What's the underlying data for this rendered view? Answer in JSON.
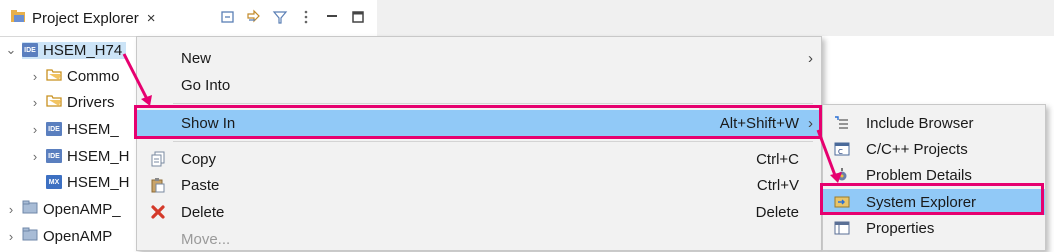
{
  "explorer": {
    "tab_title": "Project Explorer",
    "close_glyph": "×",
    "toolbar_icons": [
      "collapse-all-icon",
      "link-with-editor-icon",
      "filter-icon",
      "view-menu-icon",
      "minimize-icon",
      "maximize-icon"
    ],
    "tree": [
      {
        "label": "HSEM_H74",
        "icon": "ide-project-icon",
        "badge": "IDE",
        "expanded": true,
        "selected": true
      },
      {
        "label": "Commo",
        "icon": "folder-icon",
        "expanded": false
      },
      {
        "label": "Drivers",
        "icon": "folder-icon",
        "expanded": false
      },
      {
        "label": "HSEM_",
        "icon": "ide-project-icon",
        "badge": "IDE",
        "expanded": false
      },
      {
        "label": "HSEM_H",
        "icon": "ide-project-icon",
        "badge": "IDE",
        "expanded": false
      },
      {
        "label": "HSEM_H",
        "icon": "mx-file-icon",
        "badge": "MX",
        "expanded": false
      },
      {
        "label": "OpenAMP_",
        "icon": "closed-project-icon",
        "expanded": false
      },
      {
        "label": "OpenAMP",
        "icon": "closed-project-icon",
        "expanded": false
      }
    ]
  },
  "context_menu": {
    "items": [
      {
        "label": "New",
        "submenu": true
      },
      {
        "label": "Go Into"
      },
      {
        "label": "Show In",
        "accelerator": "Alt+Shift+W",
        "submenu": true,
        "highlighted": true
      },
      {
        "label": "Copy",
        "accelerator": "Ctrl+C",
        "icon": "copy-icon"
      },
      {
        "label": "Paste",
        "accelerator": "Ctrl+V",
        "icon": "paste-icon"
      },
      {
        "label": "Delete",
        "accelerator": "Delete",
        "icon": "delete-icon"
      },
      {
        "label": "Move...",
        "disabled": true
      }
    ],
    "arrow_glyph": "›"
  },
  "show_in_submenu": {
    "items": [
      {
        "label": "Include Browser",
        "icon": "include-browser-icon"
      },
      {
        "label": "C/C++ Projects",
        "icon": "cpp-projects-icon"
      },
      {
        "label": "Problem Details",
        "icon": "problem-details-icon"
      },
      {
        "label": "System Explorer",
        "icon": "system-explorer-icon",
        "highlighted": true
      },
      {
        "label": "Properties",
        "icon": "properties-icon"
      }
    ]
  },
  "colors": {
    "highlight": "#91c9f7",
    "annotation": "#e6006f",
    "selection": "#cce4f7"
  }
}
